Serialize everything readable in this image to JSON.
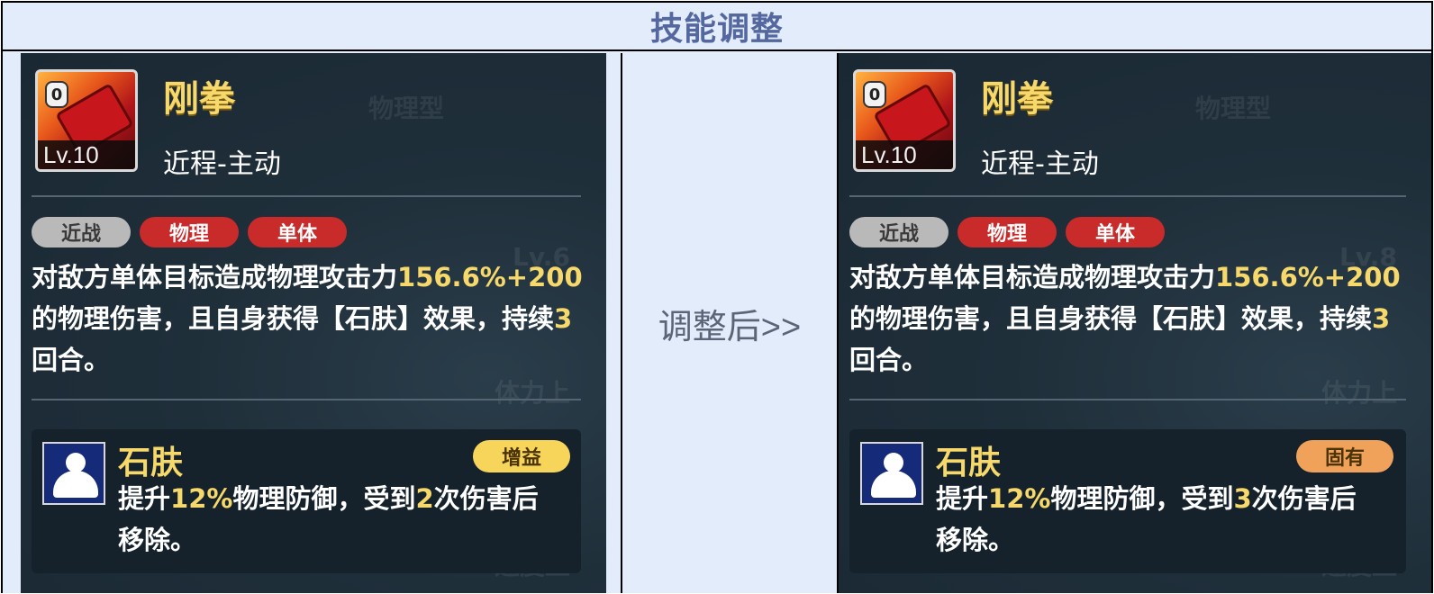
{
  "header": {
    "title": "技能调整"
  },
  "middle": {
    "label": "调整后>>"
  },
  "before": {
    "skill": {
      "name": "刚拳",
      "level": "Lv.10",
      "cost": "0",
      "subtitle": "近程-主动"
    },
    "tags": [
      "近战",
      "物理",
      "单体"
    ],
    "description": {
      "p1": "对敌方单体目标造成物理攻击力",
      "v1": "156.6%+200",
      "p2": "的物理伤害，且自身获得【石肤】效果，持续",
      "v2": "3",
      "p3": "回合。"
    },
    "buff": {
      "name": "石肤",
      "badge": "增益",
      "badge_color": "#f7d55b",
      "desc": {
        "p1": "提升",
        "v1": "12%",
        "p2": "物理防御，受到",
        "v2": "2",
        "p3": "次伤害后移除。"
      }
    },
    "background_text": [
      "物理型",
      "Lv.6",
      "体力上",
      "速度上"
    ]
  },
  "after": {
    "skill": {
      "name": "刚拳",
      "level": "Lv.10",
      "cost": "0",
      "subtitle": "近程-主动"
    },
    "tags": [
      "近战",
      "物理",
      "单体"
    ],
    "description": {
      "p1": "对敌方单体目标造成物理攻击力",
      "v1": "156.6%+200",
      "p2": "的物理伤害，且自身获得【石肤】效果，持续",
      "v2": "3",
      "p3": "回合。"
    },
    "buff": {
      "name": "石肤",
      "badge": "固有",
      "badge_color": "#f0a25a",
      "desc": {
        "p1": "提升",
        "v1": "12%",
        "p2": "物理防御，受到",
        "v2": "3",
        "p3": "次伤害后移除。"
      }
    },
    "background_text": [
      "物理型",
      "Lv.8",
      "体力上",
      "速度上"
    ]
  },
  "colors": {
    "highlight": "#f6d96a",
    "tag_red": "#c92a2a",
    "tag_gray": "#b9b9b9",
    "header_bg": "#e3ecfb",
    "header_text": "#54689f"
  },
  "icons": {
    "skill": "fist-skill-icon",
    "buff": "flexing-muscle-icon"
  }
}
